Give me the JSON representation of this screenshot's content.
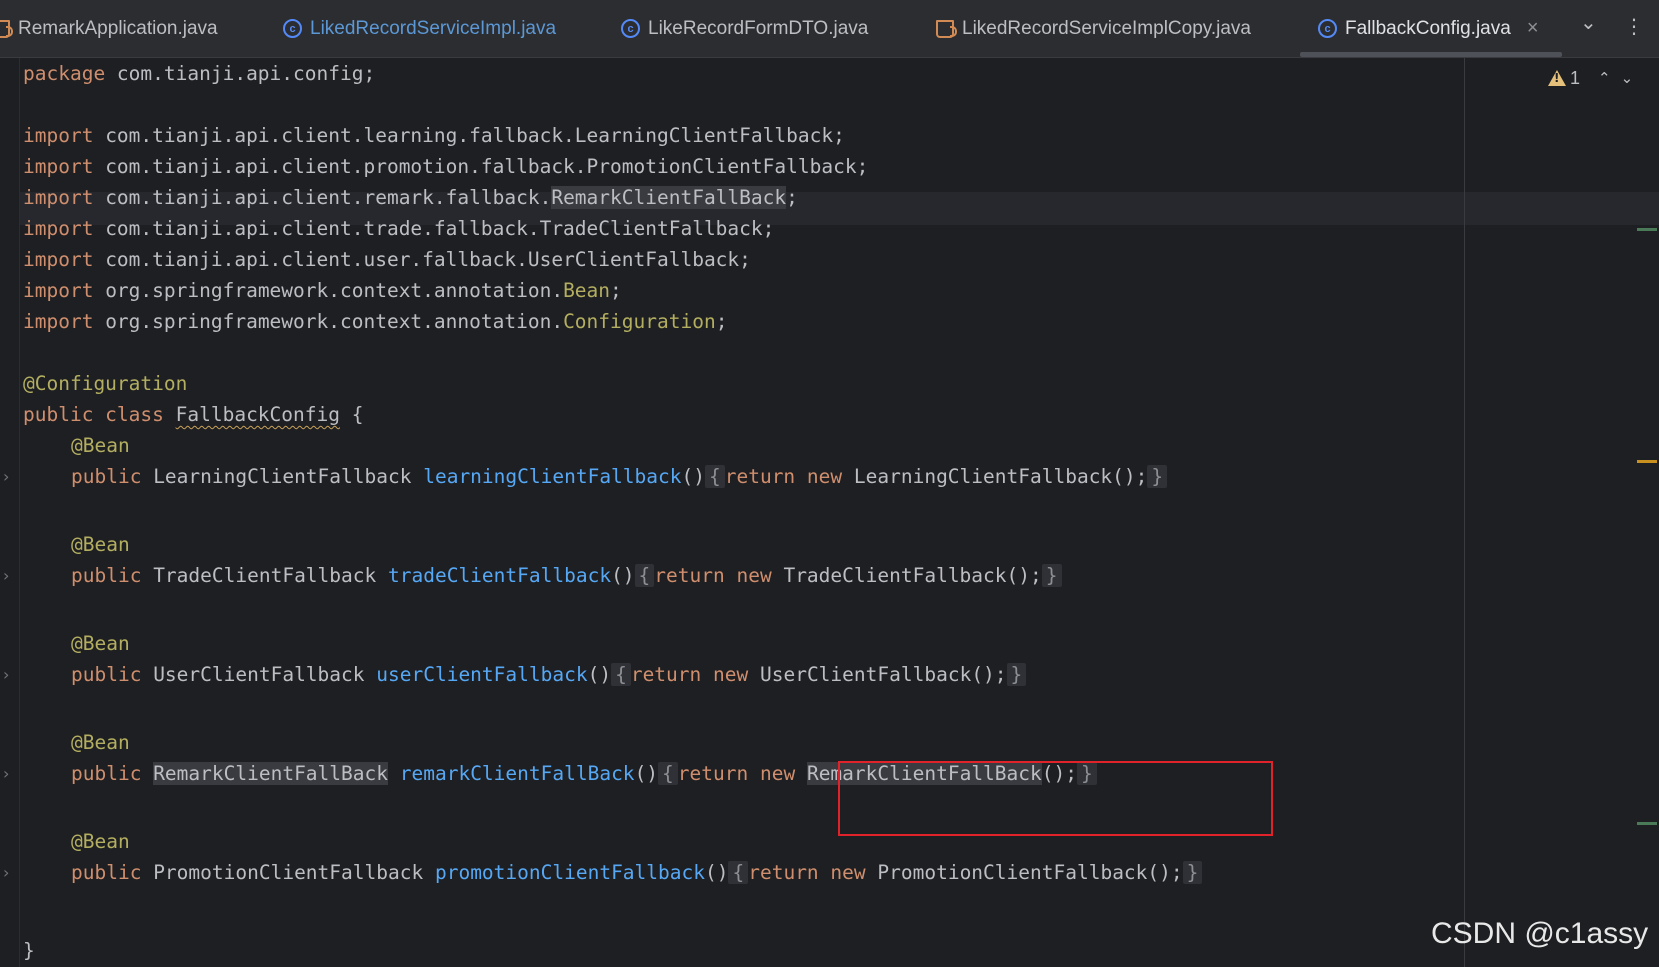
{
  "tabs": [
    {
      "label": "RemarkApplication.java",
      "icon": "java-file-icon",
      "modified": false
    },
    {
      "label": "LikedRecordServiceImpl.java",
      "icon": "class-icon",
      "modified": true
    },
    {
      "label": "LikeRecordFormDTO.java",
      "icon": "class-icon",
      "modified": false
    },
    {
      "label": "LikedRecordServiceImplCopy.java",
      "icon": "java-file-icon",
      "modified": false
    },
    {
      "label": "FallbackConfig.java",
      "icon": "class-icon",
      "modified": false,
      "active": true
    }
  ],
  "tab_icon_glyph": "c",
  "close_glyph": "×",
  "more_tabs_glyph": "⌄",
  "options_glyph": "⋮",
  "inspection": {
    "warning_count": "1",
    "up_glyph": "⌃",
    "down_glyph": "⌄"
  },
  "fold_glyph": "›",
  "code": {
    "package_kw": "package",
    "package_name": " com.tianji.api.config;",
    "import_kw": "import",
    "imports": [
      {
        "path": " com.tianji.api.client.learning.fallback.",
        "name": "LearningClientFallback",
        "tail": ";"
      },
      {
        "path": " com.tianji.api.client.promotion.fallback.",
        "name": "PromotionClientFallback",
        "tail": ";"
      },
      {
        "path": " com.tianji.api.client.remark.fallback.",
        "name": "RemarkClientFallBack",
        "tail": ";"
      },
      {
        "path": " com.tianji.api.client.trade.fallback.",
        "name": "TradeClientFallback",
        "tail": ";"
      },
      {
        "path": " com.tianji.api.client.user.fallback.",
        "name": "UserClientFallback",
        "tail": ";"
      },
      {
        "path": " org.springframework.context.annotation.",
        "name": "Bean",
        "tail": ";"
      },
      {
        "path": " org.springframework.context.annotation.",
        "name": "Configuration",
        "tail": ";"
      }
    ],
    "class_annotation": "@Configuration",
    "class_kw": "public class ",
    "class_name": "FallbackConfig",
    "class_open": " {",
    "bean_annotation": "@Bean",
    "public_kw": "public ",
    "return_kw": "return ",
    "new_kw": "new ",
    "open_brace": "{",
    "close_brace": "}",
    "methods": [
      {
        "type": "LearningClientFallback",
        "name": "learningClientFallback",
        "ctor": "LearningClientFallback"
      },
      {
        "type": "TradeClientFallback",
        "name": "tradeClientFallback",
        "ctor": "TradeClientFallback"
      },
      {
        "type": "UserClientFallback",
        "name": "userClientFallback",
        "ctor": "UserClientFallback"
      },
      {
        "type": "RemarkClientFallBack",
        "name": "remarkClientFallBack",
        "ctor": "RemarkClientFallBack"
      },
      {
        "type": "PromotionClientFallback",
        "name": "promotionClientFallback",
        "ctor": "PromotionClientFallback"
      }
    ],
    "parens": "()",
    "ctor_tail": "();",
    "last_line": "}"
  },
  "watermark": "CSDN @c1assy",
  "colors": {
    "keyword": "#cf8e6d",
    "annotation": "#b3ae60",
    "method": "#56a8f5",
    "highlight_box": "#e0222b"
  }
}
